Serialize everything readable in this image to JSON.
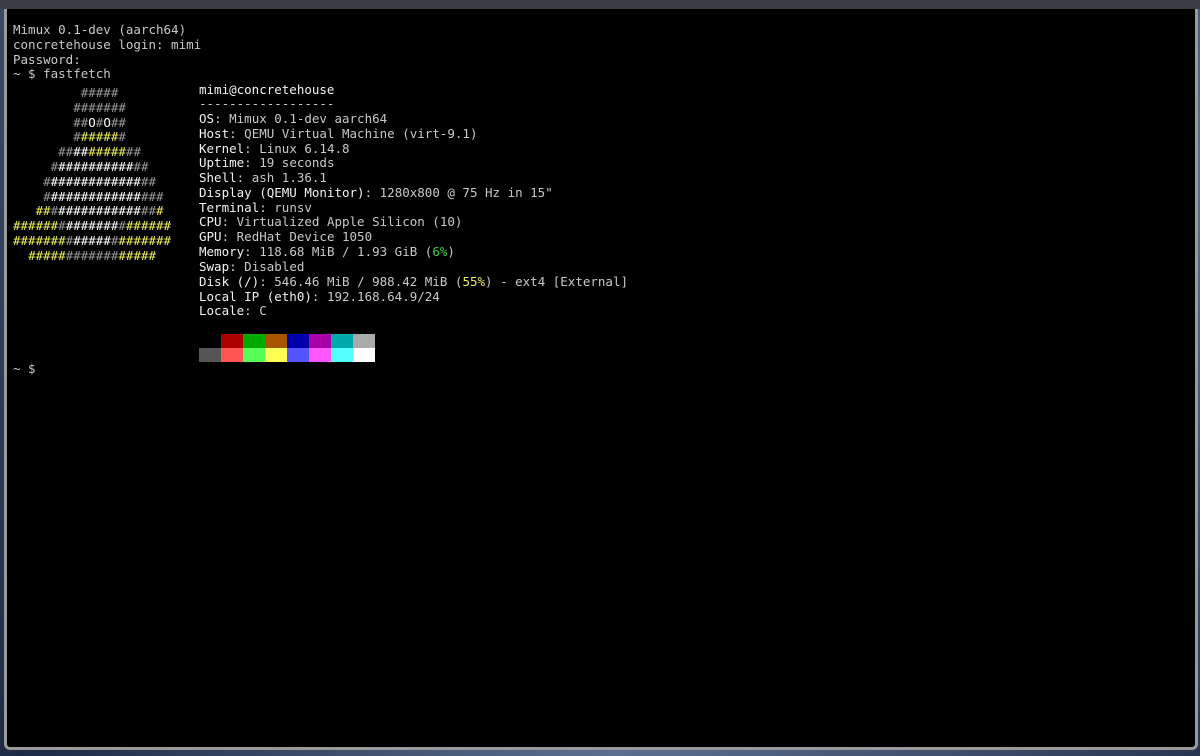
{
  "boot": {
    "line1": "Mimux 0.1-dev (aarch64)",
    "line2": "concretehouse login: mimi",
    "line3": "Password:",
    "prompt_cmd": "~ $ fastfetch"
  },
  "info": {
    "user_host": "mimi@concretehouse",
    "separator": "------------------",
    "rows": [
      {
        "key": "OS",
        "value": "Mimux 0.1-dev aarch64"
      },
      {
        "key": "Host",
        "value": "QEMU Virtual Machine (virt-9.1)"
      },
      {
        "key": "Kernel",
        "value": "Linux 6.14.8"
      },
      {
        "key": "Uptime",
        "value": "19 seconds"
      },
      {
        "key": "Shell",
        "value": "ash 1.36.1"
      },
      {
        "key": "Display (QEMU Monitor)",
        "value": "1280x800 @ 75 Hz in 15\""
      },
      {
        "key": "Terminal",
        "value": "runsv"
      },
      {
        "key": "CPU",
        "value": "Virtualized Apple Silicon (10)"
      },
      {
        "key": "GPU",
        "value": "RedHat Device 1050"
      }
    ],
    "memory": {
      "key": "Memory",
      "value_pre": "118.68 MiB / 1.93 GiB (",
      "pct": "6%",
      "value_post": ")"
    },
    "swap": {
      "key": "Swap",
      "value": "Disabled"
    },
    "disk": {
      "key": "Disk (/)",
      "value_pre": "546.46 MiB / 988.42 MiB (",
      "pct": "55%",
      "value_post": ") - ext4 [External]"
    },
    "local_ip": {
      "key": "Local IP (eth0)",
      "value": "192.168.64.9/24"
    },
    "locale": {
      "key": "Locale",
      "value": "C"
    }
  },
  "palette": {
    "row1": [
      "#000000",
      "#aa0000",
      "#00aa00",
      "#aa5500",
      "#0000aa",
      "#aa00aa",
      "#00aaaa",
      "#aaaaaa"
    ],
    "row2": [
      "#555555",
      "#ff5555",
      "#55ff55",
      "#ffff55",
      "#5555ff",
      "#ff55ff",
      "#55ffff",
      "#ffffff"
    ]
  },
  "final_prompt": "~ $"
}
